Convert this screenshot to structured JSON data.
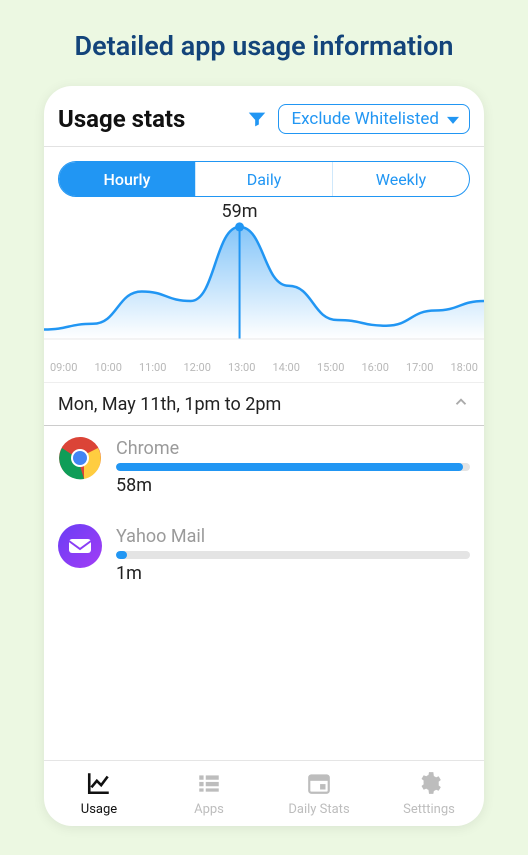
{
  "banner": "Detailed app usage information",
  "header": {
    "title": "Usage stats",
    "filter_label": "Exclude Whitelisted"
  },
  "segments": {
    "items": [
      "Hourly",
      "Daily",
      "Weekly"
    ],
    "active_index": 0
  },
  "chart_data": {
    "type": "line",
    "xlabel": "",
    "ylabel": "",
    "x_ticks": [
      "09:00",
      "10:00",
      "11:00",
      "12:00",
      "13:00",
      "14:00",
      "15:00",
      "16:00",
      "17:00",
      "18:00"
    ],
    "x": [
      9,
      10,
      11,
      12,
      13,
      14,
      15,
      16,
      17,
      18
    ],
    "values": [
      5,
      8,
      25,
      20,
      59,
      28,
      10,
      7,
      15,
      20
    ],
    "peak_label": "59m",
    "peak_x": 13,
    "ylim": [
      0,
      60
    ]
  },
  "range": {
    "label": "Mon, May 11th, 1pm to 2pm"
  },
  "apps": [
    {
      "name": "Chrome",
      "time_label": "58m",
      "fraction": 0.98,
      "icon": "chrome"
    },
    {
      "name": "Yahoo Mail",
      "time_label": "1m",
      "fraction": 0.03,
      "icon": "mail"
    }
  ],
  "nav": {
    "items": [
      "Usage",
      "Apps",
      "Daily Stats",
      "Setttings"
    ],
    "active_index": 0
  }
}
